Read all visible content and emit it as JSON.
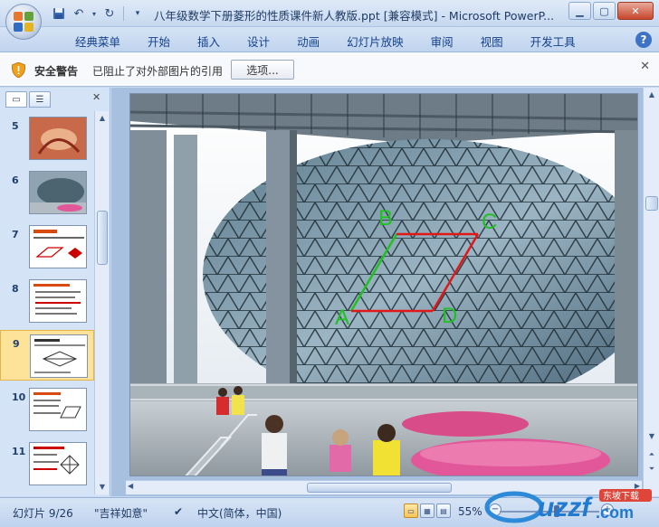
{
  "window": {
    "title": "八年级数学下册菱形的性质课件新人教版.ppt [兼容模式] - Microsoft PowerP...",
    "minimize_icon": "minimize-icon",
    "maximize_icon": "maximize-icon",
    "close_icon": "close-icon"
  },
  "ribbon": {
    "tabs": [
      "经典菜单",
      "开始",
      "插入",
      "设计",
      "动画",
      "幻灯片放映",
      "审阅",
      "视图",
      "开发工具"
    ],
    "help_label": "?"
  },
  "security": {
    "title": "安全警告",
    "message": "已阻止了对外部图片的引用",
    "options_button": "选项..."
  },
  "slide_pane": {
    "thumbnails": [
      {
        "number": "5",
        "kind": "photo-red"
      },
      {
        "number": "6",
        "kind": "photo-building"
      },
      {
        "number": "7",
        "kind": "text-diagram"
      },
      {
        "number": "8",
        "kind": "text-list"
      },
      {
        "number": "9",
        "kind": "text-rhombus",
        "selected": true
      },
      {
        "number": "10",
        "kind": "text-parallelogram"
      },
      {
        "number": "11",
        "kind": "text-rhombus-red"
      }
    ]
  },
  "slide": {
    "labels": {
      "a": "A",
      "b": "B",
      "c": "C",
      "d": "D"
    },
    "colors": {
      "green": "#20c020",
      "red": "#e01818"
    }
  },
  "status": {
    "slide_counter": "幻灯片 9/26",
    "theme": "\"吉祥如意\"",
    "language": "中文(简体，中国)",
    "zoom": "55%"
  },
  "watermark": {
    "brand": "uzzf",
    "domain": ".com",
    "tag": "东坡下载"
  }
}
